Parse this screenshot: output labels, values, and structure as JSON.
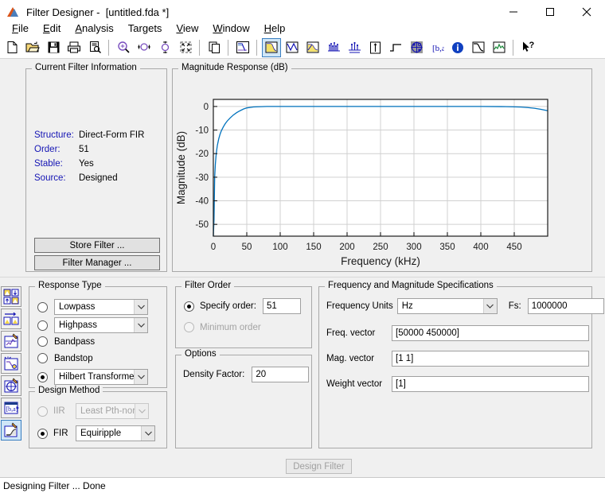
{
  "window": {
    "title": "Filter Designer -  [untitled.fda *]",
    "app_icon": "matlab-peaks-icon",
    "controls": [
      {
        "name": "minimize-button",
        "glyph": "minimize-icon"
      },
      {
        "name": "maximize-button",
        "glyph": "maximize-icon"
      },
      {
        "name": "close-button",
        "glyph": "close-icon"
      }
    ]
  },
  "menubar": {
    "items": [
      {
        "label": "File",
        "mnemonic": "F"
      },
      {
        "label": "Edit",
        "mnemonic": "E"
      },
      {
        "label": "Analysis",
        "mnemonic": "A"
      },
      {
        "label": "Targets",
        "mnemonic": "g"
      },
      {
        "label": "View",
        "mnemonic": "V"
      },
      {
        "label": "Window",
        "mnemonic": "W"
      },
      {
        "label": "Help",
        "mnemonic": "H"
      }
    ]
  },
  "toolbar": {
    "buttons": [
      {
        "name": "new-filter-icon",
        "title": "New"
      },
      {
        "name": "open-session-icon",
        "title": "Open"
      },
      {
        "name": "save-session-icon",
        "title": "Save"
      },
      {
        "name": "print-icon",
        "title": "Print"
      },
      {
        "name": "print-preview-icon",
        "title": "Print Preview"
      },
      {
        "name": "zoom-in-icon",
        "title": "Zoom In"
      },
      {
        "name": "zoom-x-icon",
        "title": "Zoom X"
      },
      {
        "name": "zoom-y-icon",
        "title": "Zoom Y"
      },
      {
        "name": "full-view-icon",
        "title": "Restore Full View"
      },
      {
        "name": "overlay-icon",
        "title": "Overlay"
      },
      {
        "name": "filter-spec-icon",
        "title": "Filter Specifications"
      },
      {
        "name": "magnitude-response-icon",
        "title": "Magnitude Response",
        "selected": true
      },
      {
        "name": "phase-response-icon",
        "title": "Phase Response"
      },
      {
        "name": "magnitude-phase-icon",
        "title": "Magnitude and Phase"
      },
      {
        "name": "group-delay-icon",
        "title": "Group Delay"
      },
      {
        "name": "phase-delay-icon",
        "title": "Phase Delay"
      },
      {
        "name": "impulse-response-icon",
        "title": "Impulse Response"
      },
      {
        "name": "step-response-icon",
        "title": "Step Response"
      },
      {
        "name": "pole-zero-icon",
        "title": "Pole/Zero Plot"
      },
      {
        "name": "filter-coefficients-icon",
        "title": "Filter Coefficients"
      },
      {
        "name": "filter-information-icon",
        "title": "Filter Information"
      },
      {
        "name": "magnitude-estimate-icon",
        "title": "Magnitude Response Estimate"
      },
      {
        "name": "round-off-noise-icon",
        "title": "Round-off Noise Power"
      },
      {
        "name": "whats-this-icon",
        "title": "What's This?"
      }
    ]
  },
  "sidebar": {
    "buttons": [
      {
        "name": "sidebar-design-filter-icon",
        "title": "Design Filter",
        "selected": false
      },
      {
        "name": "sidebar-import-filter-icon",
        "title": "Import Filter",
        "selected": false
      },
      {
        "name": "sidebar-quantize-filter-icon",
        "title": "Set Quantization Parameters",
        "selected": false
      },
      {
        "name": "sidebar-transform-filter-icon",
        "title": "Transform Filter",
        "selected": false
      },
      {
        "name": "sidebar-realize-model-icon",
        "title": "Realize Model",
        "selected": false
      },
      {
        "name": "sidebar-pole-zero-editor-icon",
        "title": "Pole/Zero Editor",
        "selected": false
      },
      {
        "name": "sidebar-set-design-icon",
        "title": "Design Filter",
        "selected": true
      }
    ]
  },
  "filter_info": {
    "legend": "Current Filter Information",
    "rows": [
      {
        "key": "Structure:",
        "value": "Direct-Form FIR"
      },
      {
        "key": "Order:",
        "value": "51"
      },
      {
        "key": "Stable:",
        "value": "Yes"
      },
      {
        "key": "Source:",
        "value": "Designed"
      }
    ],
    "store_filter_label": "Store Filter ...",
    "filter_manager_label": "Filter Manager ..."
  },
  "plot_panel": {
    "legend": "Magnitude Response (dB)"
  },
  "chart_data": {
    "type": "line",
    "title": "Magnitude Response (dB)",
    "xlabel": "Frequency (kHz)",
    "ylabel": "Magnitude (dB)",
    "xlim": [
      0,
      500
    ],
    "ylim": [
      -55,
      3
    ],
    "xticks": [
      0,
      50,
      100,
      150,
      200,
      250,
      300,
      350,
      400,
      450
    ],
    "yticks": [
      0,
      -10,
      -20,
      -30,
      -40,
      -50
    ],
    "grid": true,
    "legend_position": "none",
    "line_color": "#0072bd",
    "series": [
      {
        "name": "Magnitude",
        "x": [
          0,
          1,
          2,
          3,
          4,
          5,
          6,
          8,
          10,
          12,
          15,
          18,
          21,
          25,
          30,
          35,
          40,
          45,
          50,
          60,
          80,
          100,
          150,
          200,
          250,
          300,
          350,
          400,
          430,
          450,
          460,
          470,
          480,
          490,
          495,
          500
        ],
        "y": [
          -55,
          -48,
          -30,
          -24.5,
          -21,
          -18.5,
          -16.5,
          -13.8,
          -11.8,
          -10.3,
          -8.6,
          -7.2,
          -6.1,
          -4.9,
          -3.6,
          -2.6,
          -1.8,
          -1.1,
          -0.6,
          -0.2,
          0.0,
          0.0,
          0.0,
          0.0,
          0.0,
          0.0,
          0.0,
          0.0,
          -0.05,
          -0.15,
          -0.25,
          -0.45,
          -0.75,
          -1.2,
          -1.5,
          -1.8
        ]
      }
    ]
  },
  "response_type": {
    "legend": "Response Type",
    "options": [
      {
        "label": "Lowpass",
        "type": "combo",
        "selected": false
      },
      {
        "label": "Highpass",
        "type": "combo",
        "selected": false
      },
      {
        "label": "Bandpass",
        "type": "radio",
        "selected": false
      },
      {
        "label": "Bandstop",
        "type": "radio",
        "selected": false
      },
      {
        "label": "Hilbert Transformer",
        "type": "combo",
        "selected": true
      }
    ]
  },
  "design_method": {
    "legend": "Design Method",
    "iir": {
      "label": "IIR",
      "value": "Least Pth-norm",
      "selected": false,
      "enabled": false
    },
    "fir": {
      "label": "FIR",
      "value": "Equiripple",
      "selected": true,
      "enabled": true
    }
  },
  "filter_order": {
    "legend": "Filter Order",
    "specify_label": "Specify order:",
    "specify_value": "51",
    "specify_selected": true,
    "minimum_label": "Minimum order",
    "minimum_selected": false,
    "minimum_enabled": false
  },
  "options": {
    "legend": "Options",
    "density_factor_label": "Density Factor:",
    "density_factor_value": "20"
  },
  "freq_mag": {
    "legend": "Frequency and Magnitude Specifications",
    "freq_units_label": "Frequency Units",
    "freq_units_value": "Hz",
    "fs_label": "Fs:",
    "fs_value": "1000000",
    "freq_vector_label": "Freq. vector",
    "freq_vector_value": "[50000 450000]",
    "mag_vector_label": "Mag. vector",
    "mag_vector_value": "[1 1]",
    "weight_vector_label": "Weight vector",
    "weight_vector_value": "[1]"
  },
  "design_filter_button": {
    "label": "Design Filter",
    "enabled": false
  },
  "statusbar": {
    "text": "Designing Filter ... Done"
  },
  "colors": {
    "accent_blue": "#0072bd",
    "label_blue": "#1414b4",
    "panel_bg": "#f0f0f0",
    "selection_blue": "#cfe6f7"
  }
}
